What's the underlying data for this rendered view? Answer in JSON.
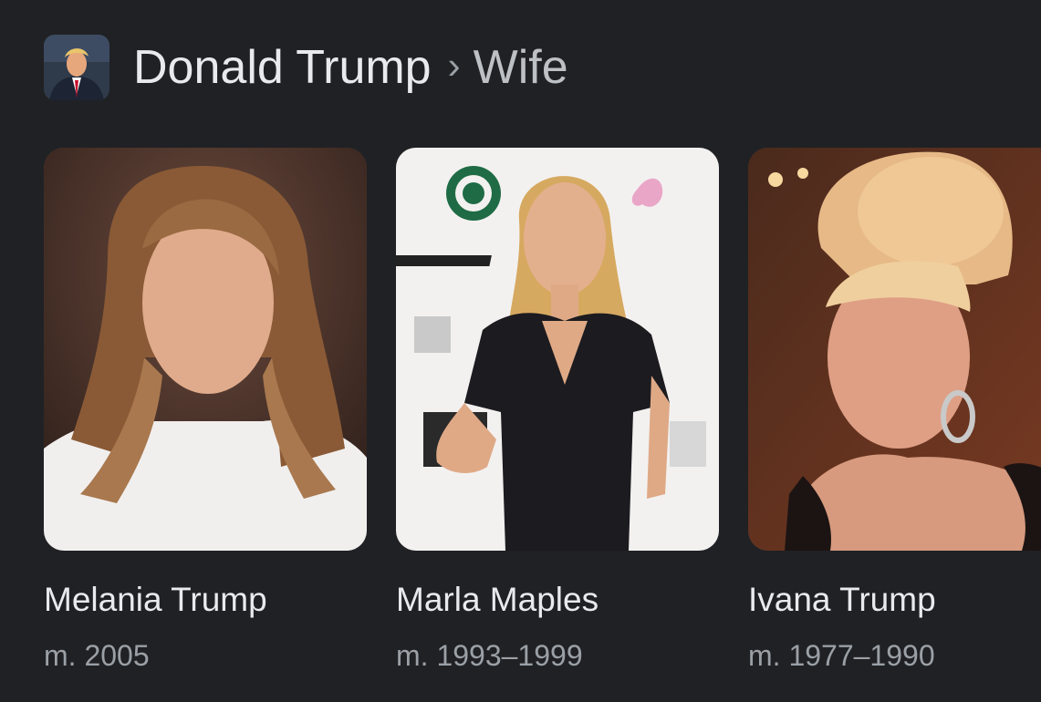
{
  "header": {
    "avatar_icon": "person-portrait-icon",
    "subject": "Donald Trump",
    "separator": "›",
    "attribute": "Wife"
  },
  "cards": [
    {
      "name": "Melania Trump",
      "detail": "m. 2005"
    },
    {
      "name": "Marla Maples",
      "detail": "m. 1993–1999"
    },
    {
      "name": "Ivana Trump",
      "detail": "m. 1977–1990"
    }
  ],
  "colors": {
    "background": "#202124",
    "primary_text": "#e8eaed",
    "secondary_text": "#9aa0a6"
  }
}
